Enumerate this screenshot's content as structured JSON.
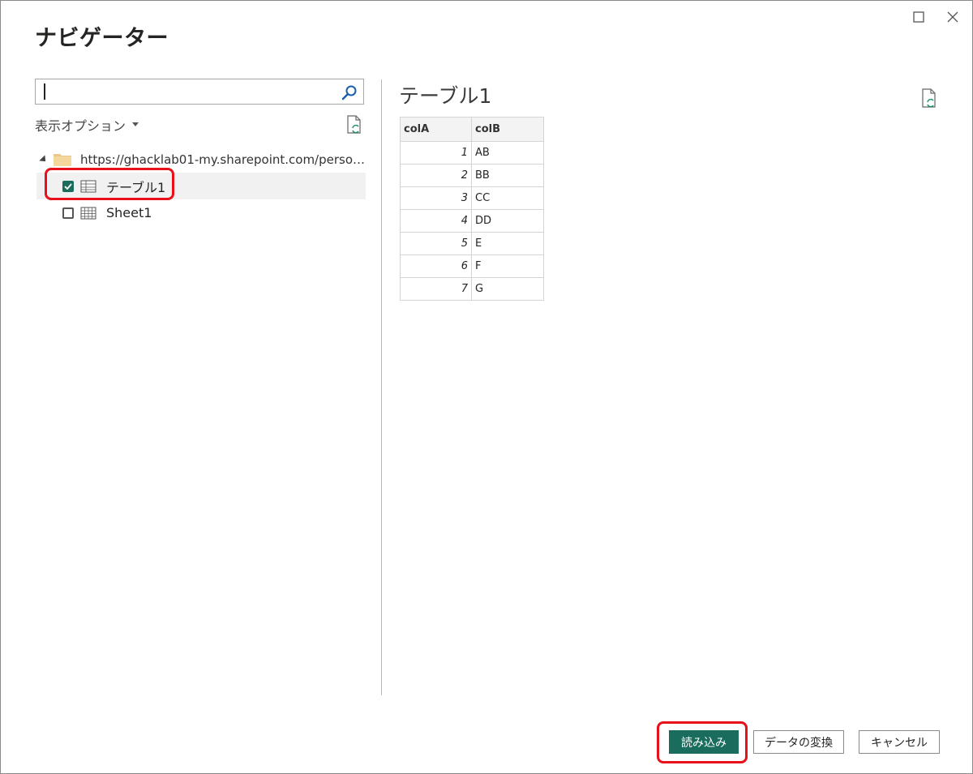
{
  "window": {
    "title": "ナビゲーター",
    "controls": [
      "maximize-icon",
      "close-icon"
    ]
  },
  "navigator": {
    "search": {
      "value": "",
      "placeholder": ""
    },
    "display_options_label": "表示オプション",
    "tree": {
      "root_label": "https://ghacklab01-my.sharepoint.com/person...",
      "items": [
        {
          "label": "テーブル1",
          "checked": true,
          "icon": "table-icon"
        },
        {
          "label": "Sheet1",
          "checked": false,
          "icon": "sheet-icon"
        }
      ]
    }
  },
  "preview": {
    "title": "テーブル1",
    "columns": [
      "colA",
      "colB"
    ],
    "rows": [
      [
        "1",
        "AB"
      ],
      [
        "2",
        "BB"
      ],
      [
        "3",
        "CC"
      ],
      [
        "4",
        "DD"
      ],
      [
        "5",
        "E"
      ],
      [
        "6",
        "F"
      ],
      [
        "7",
        "G"
      ]
    ]
  },
  "footer": {
    "load_label": "読み込み",
    "transform_label": "データの変換",
    "cancel_label": "キャンセル"
  },
  "colors": {
    "accent": "#1a6d5c",
    "highlight": "#e8101a"
  }
}
